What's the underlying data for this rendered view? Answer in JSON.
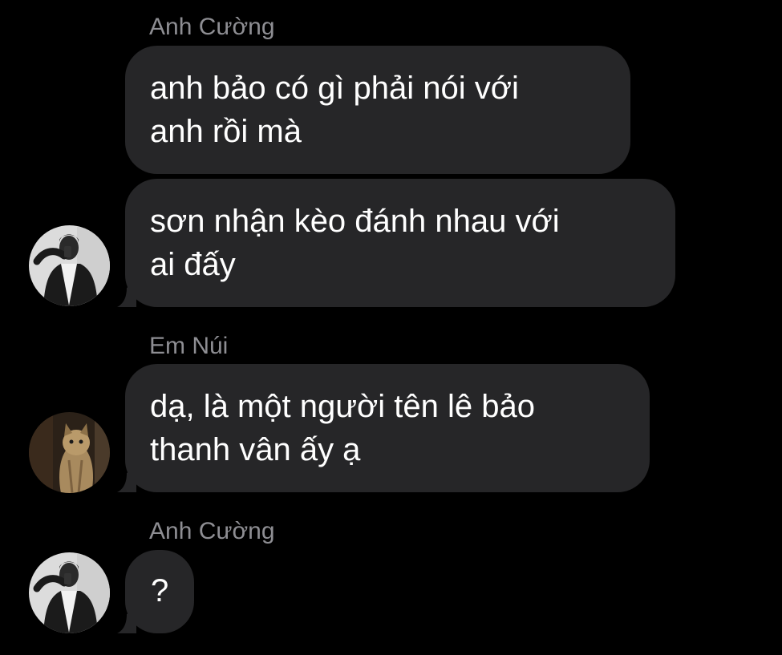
{
  "conversation": {
    "groups": [
      {
        "sender": "Anh Cường",
        "avatar_icon": "person-photo-avatar",
        "messages": [
          {
            "lines": [
              "anh bảo có gì phải nói với",
              "anh rồi mà"
            ]
          },
          {
            "lines": [
              "sơn nhận kèo đánh nhau với",
              "ai đấy"
            ]
          }
        ]
      },
      {
        "sender": "Em Núi",
        "avatar_icon": "cat-photo-avatar",
        "messages": [
          {
            "lines": [
              "dạ, là một người tên lê bảo",
              "thanh vân ấy ạ"
            ]
          }
        ]
      },
      {
        "sender": "Anh Cường",
        "avatar_icon": "person-photo-avatar",
        "messages": [
          {
            "lines": [
              "?"
            ]
          }
        ]
      }
    ]
  },
  "colors": {
    "background": "#000000",
    "bubble": "#262628",
    "message_text": "#ffffff",
    "sender_name": "#8e8e93"
  }
}
